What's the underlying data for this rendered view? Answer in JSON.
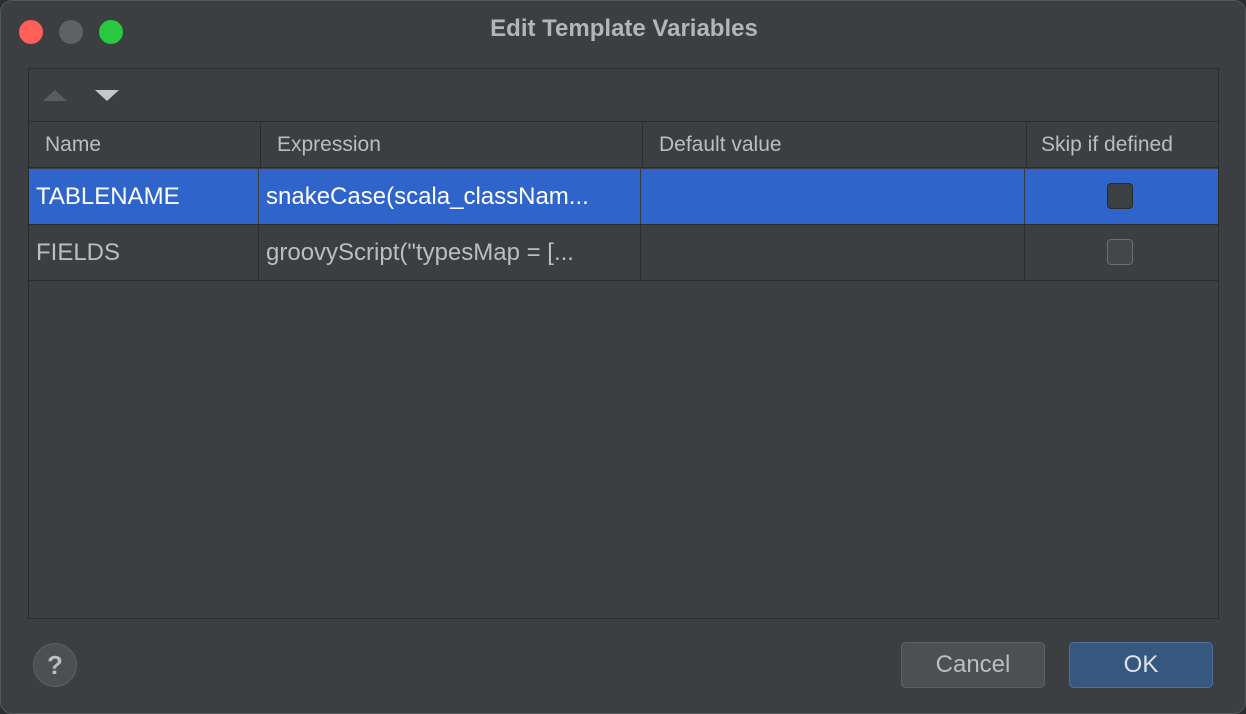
{
  "window": {
    "title": "Edit Template Variables"
  },
  "toolbar": {
    "move_up_icon": "triangle-up-icon",
    "move_down_icon": "triangle-down-icon"
  },
  "table": {
    "columns": [
      "Name",
      "Expression",
      "Default value",
      "Skip if defined"
    ],
    "rows": [
      {
        "name": "TABLENAME",
        "expression": "snakeCase(scala_classNam...",
        "default_value": "",
        "skip_if_defined": false,
        "selected": true
      },
      {
        "name": "FIELDS",
        "expression": "groovyScript(\"typesMap = [...",
        "default_value": "",
        "skip_if_defined": false,
        "selected": false
      }
    ]
  },
  "footer": {
    "help_label": "?",
    "cancel_label": "Cancel",
    "ok_label": "OK"
  },
  "colors": {
    "selection": "#2f65ca",
    "ok_button": "#365880",
    "background": "#3c3f41"
  }
}
